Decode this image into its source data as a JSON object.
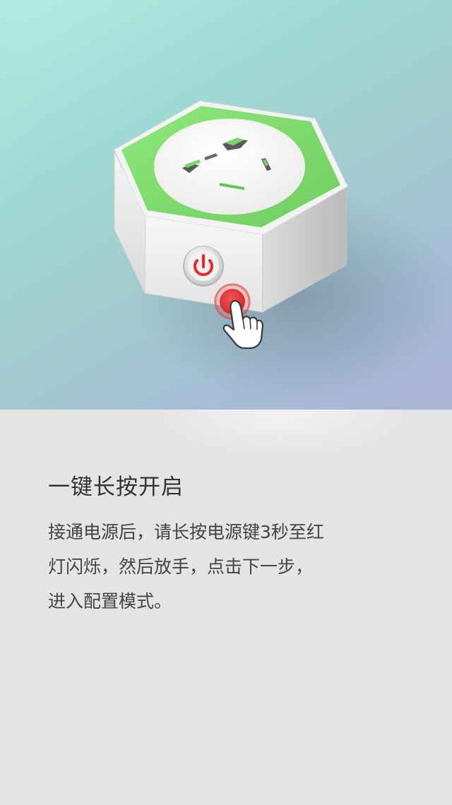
{
  "hero": {
    "illustration": "smart-plug-power-button-long-press",
    "colors": {
      "background_start": "#b3ece4",
      "background_end": "#acb4d7",
      "plug_top": "#7ed96d",
      "plug_body": "#eeeeee",
      "power_icon": "#e8262b",
      "touch_point": "#e53a3e"
    }
  },
  "instruction": {
    "title": "一键长按开启",
    "lines": [
      "接通电源后，请长按电源键3秒至红",
      "灯闪烁，然后放手，点击下一步，",
      "进入配置模式。"
    ]
  }
}
